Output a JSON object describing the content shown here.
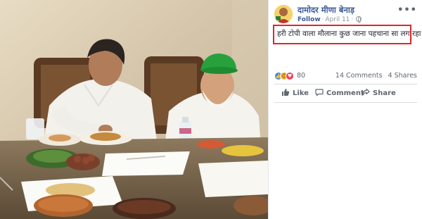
{
  "post": {
    "author": "दामोदर मीणा बेनाड़",
    "follow_label": "Follow",
    "date": "April 11",
    "status_text": "हरी टोपी वाला मौलाना कुछ जाना पहचाना सा लग रहा है",
    "more_icon": "more-options-icon",
    "privacy_icon": "globe-icon"
  },
  "reactions": {
    "count": "80",
    "comments": "14 Comments",
    "shares": "4 Shares",
    "types": [
      "like-icon",
      "haha-icon",
      "love-icon"
    ]
  },
  "actions": {
    "like": "Like",
    "comment": "Comment",
    "share": "Share"
  },
  "colors": {
    "link_blue": "#385898",
    "highlight_red": "#e0262c",
    "secondary_text": "#606770"
  }
}
